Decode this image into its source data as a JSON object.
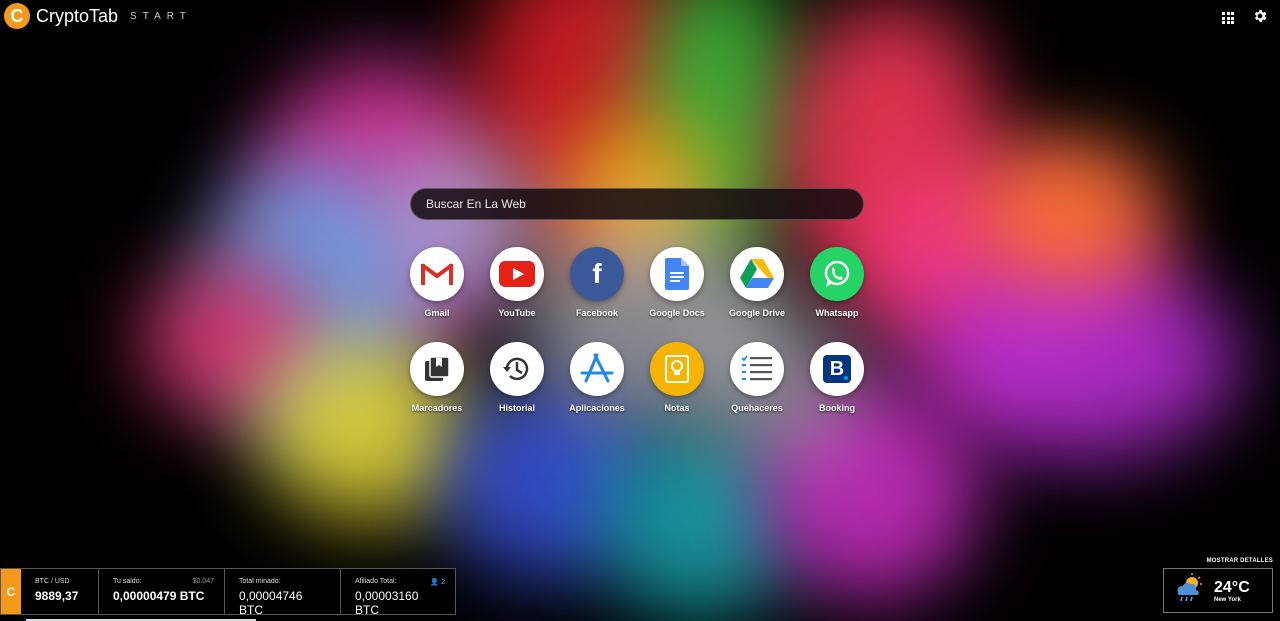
{
  "header": {
    "brand_name": "CryptoTab",
    "brand_sub": "START",
    "logo_letter": "C"
  },
  "search": {
    "placeholder": "Buscar En La Web"
  },
  "shortcuts": [
    {
      "label": "Gmail",
      "icon": "gmail-icon"
    },
    {
      "label": "YouTube",
      "icon": "youtube-icon"
    },
    {
      "label": "Facebook",
      "icon": "facebook-icon"
    },
    {
      "label": "Google Docs",
      "icon": "google-docs-icon"
    },
    {
      "label": "Google Drive",
      "icon": "google-drive-icon"
    },
    {
      "label": "Whatsapp",
      "icon": "whatsapp-icon"
    },
    {
      "label": "Marcadores",
      "icon": "bookmarks-icon"
    },
    {
      "label": "Historial",
      "icon": "history-icon"
    },
    {
      "label": "Aplicaciones",
      "icon": "app-store-icon"
    },
    {
      "label": "Notas",
      "icon": "notes-icon"
    },
    {
      "label": "Quehaceres",
      "icon": "todo-list-icon"
    },
    {
      "label": "Booking",
      "icon": "booking-icon"
    }
  ],
  "stats": {
    "btc_usd_label": "BTC / USD",
    "btc_usd_value": "9889,37",
    "balance_label": "Tu saldo:",
    "balance_usd": "$0.047",
    "balance_value": "0,00000479 BTC",
    "mined_label": "Total minado:",
    "mined_value": "0,00004746 BTC",
    "affiliate_label": "Afiliado Total:",
    "affiliate_count": "2",
    "affiliate_value": "0,00003160 BTC"
  },
  "weather": {
    "details_link": "MOSTRAR DETALLES",
    "temperature": "24°C",
    "city": "New York",
    "icon": "partly-cloudy-rain-icon"
  },
  "colors": {
    "brand_orange": "#f39a1d",
    "youtube_red": "#e62117",
    "facebook_blue": "#3b5998",
    "whatsapp_green": "#25d366",
    "notes_yellow": "#f4b400",
    "booking_blue": "#003580"
  }
}
